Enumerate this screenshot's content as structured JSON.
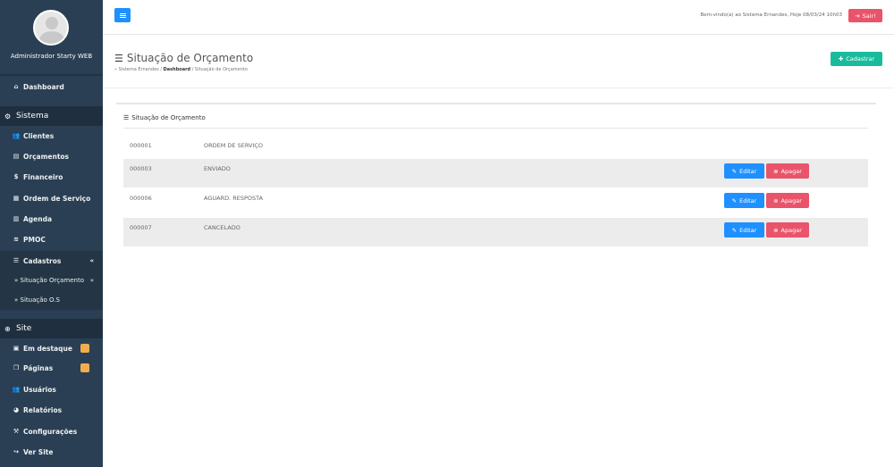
{
  "user": {
    "name": "Administrador Starty WEB"
  },
  "sidebar": {
    "dashboard": "Dashboard",
    "section_sistema": "Sistema",
    "sistema_items": [
      "Clientes",
      "Orçamentos",
      "Financeiro",
      "Ordem de Serviço",
      "Agenda",
      "PMOC",
      "Cadastros"
    ],
    "cadastros_sub": [
      "» Situação Orçamento",
      "» Situação O.S"
    ],
    "section_site": "Site",
    "site_items": [
      "Em destaque",
      "Páginas",
      "Usuários",
      "Relatórios",
      "Configurações",
      "Ver Site"
    ],
    "icons": [
      "home-icon",
      "gear-icon",
      "users-icon",
      "file-icon",
      "money-icon",
      "doc-icon",
      "calendar-icon",
      "wind-icon",
      "list-icon",
      "globe-icon"
    ]
  },
  "topbar": {
    "welcome": "Bem-vindo(a) ao Sistema Ernandes, Hoje 08/03/24 10h03",
    "logout": "Sair!"
  },
  "page": {
    "title": "Situação de Orçamento",
    "breadcrumb_root": "» Sistema Ernandes",
    "breadcrumb_mid": "Dashboard",
    "breadcrumb_current": "Situação de Orçamento",
    "add_label": "Cadastrar"
  },
  "panel": {
    "title": "Situação de Orçamento",
    "edit_label": "Editar",
    "delete_label": "Apagar",
    "rows": [
      {
        "id": "000001",
        "name": "ORDEM DE SERVIÇO"
      },
      {
        "id": "000003",
        "name": "ENVIADO"
      },
      {
        "id": "000006",
        "name": "AGUARD. RESPOSTA"
      },
      {
        "id": "000007",
        "name": "CANCELADO"
      }
    ]
  },
  "colors": {
    "sidebar": "#2a3f54",
    "primary": "#1e90ff",
    "danger": "#e9546b",
    "success": "#1abb9c",
    "badge": "#f0ad4e"
  }
}
